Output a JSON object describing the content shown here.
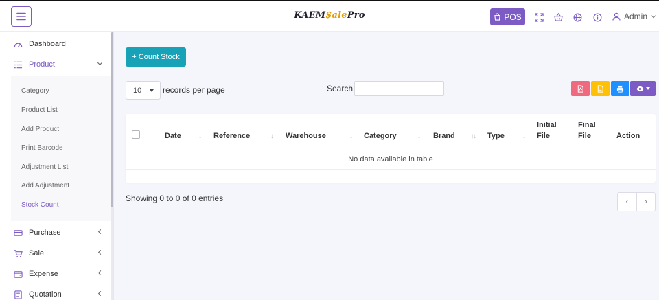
{
  "header": {
    "brand_part1": "KAEM",
    "brand_part2": "$ale",
    "brand_part3": "Pro",
    "pos_label": "POS",
    "user_label": "Admin",
    "icons": [
      "menu-icon",
      "store-icon",
      "fullscreen-icon",
      "basket-icon",
      "globe-icon",
      "info-icon",
      "user-icon",
      "chevron-down-icon"
    ]
  },
  "sidebar": {
    "items": [
      {
        "label": "Dashboard",
        "icon": "speedometer-icon"
      },
      {
        "label": "Product",
        "icon": "list-icon",
        "expanded": true
      },
      {
        "label": "Purchase",
        "icon": "card-icon"
      },
      {
        "label": "Sale",
        "icon": "cart-icon"
      },
      {
        "label": "Expense",
        "icon": "wallet-icon"
      },
      {
        "label": "Quotation",
        "icon": "document-icon"
      }
    ],
    "submenu": [
      {
        "label": "Category"
      },
      {
        "label": "Product List"
      },
      {
        "label": "Add Product"
      },
      {
        "label": "Print Barcode"
      },
      {
        "label": "Adjustment List"
      },
      {
        "label": "Add Adjustment"
      },
      {
        "label": "Stock Count",
        "active": true
      }
    ]
  },
  "main": {
    "count_stock_label": "+ Count Stock",
    "page_length": "10",
    "records_label": "records per page",
    "search_label": "Search",
    "search_value": "",
    "tool_buttons": [
      {
        "icon": "pdf-icon",
        "color": "#f06a7f"
      },
      {
        "icon": "csv-icon",
        "color": "#ffc107"
      },
      {
        "icon": "print-icon",
        "color": "#1e90ff"
      },
      {
        "icon": "eye-icon",
        "color": "#7c5cc4"
      }
    ],
    "table": {
      "headers": {
        "date": "Date",
        "reference": "Reference",
        "warehouse": "Warehouse",
        "category": "Category",
        "brand": "Brand",
        "type": "Type",
        "initial_file_1": "Initial",
        "initial_file_2": "File",
        "final_file_1": "Final",
        "final_file_2": "File",
        "action": "Action"
      },
      "sort_glyph": "↑↓",
      "empty_message": "No data available in table"
    },
    "info": "Showing 0 to 0 of 0 entries",
    "pager": {
      "prev": "‹",
      "next": "›"
    }
  },
  "colors": {
    "accent": "#7c5cc4",
    "teal": "#17a2b8",
    "brand_gold": "#e0a100"
  }
}
